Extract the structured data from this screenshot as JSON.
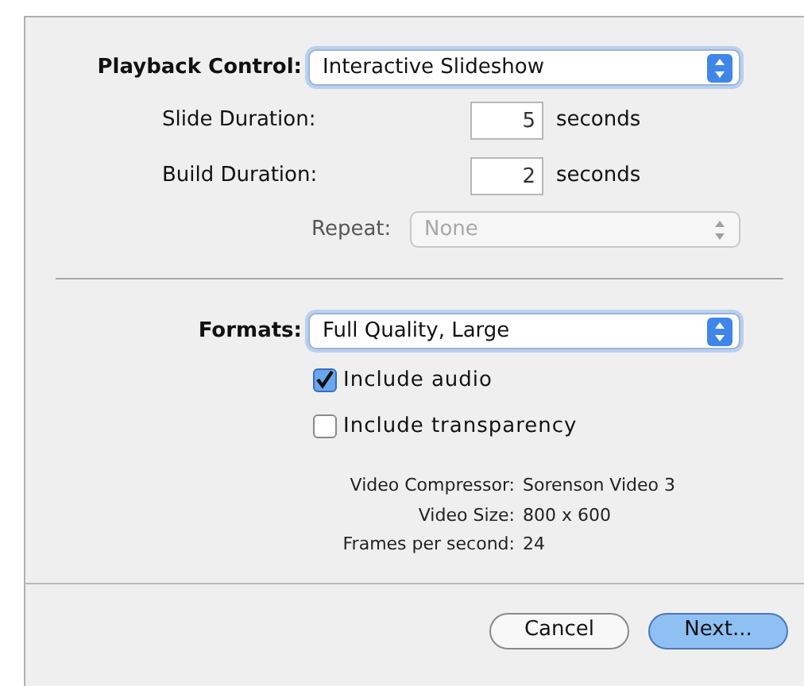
{
  "playback_control": {
    "label": "Playback Control:",
    "value": "Interactive Slideshow",
    "disabled": false
  },
  "durations": [
    {
      "label": "Slide Duration:",
      "value": "5",
      "unit": "seconds"
    },
    {
      "label": "Build Duration:",
      "value": "2",
      "unit": "seconds"
    }
  ],
  "repeat": {
    "label": "Repeat:",
    "value": "None",
    "disabled": true
  },
  "formats": {
    "label": "Formats:",
    "value": "Full Quality, Large",
    "disabled": false
  },
  "options": [
    {
      "label": "Include audio",
      "checked": true
    },
    {
      "label": "Include transparency",
      "checked": false
    }
  ],
  "info": [
    {
      "label": "Video Compressor:",
      "value": "Sorenson Video 3"
    },
    {
      "label": "Video Size:",
      "value": "800 x 600"
    },
    {
      "label": "Frames per second:",
      "value": "24"
    }
  ],
  "buttons": [
    {
      "label": "Cancel",
      "default": false
    },
    {
      "label": "Next...",
      "default": true
    }
  ]
}
